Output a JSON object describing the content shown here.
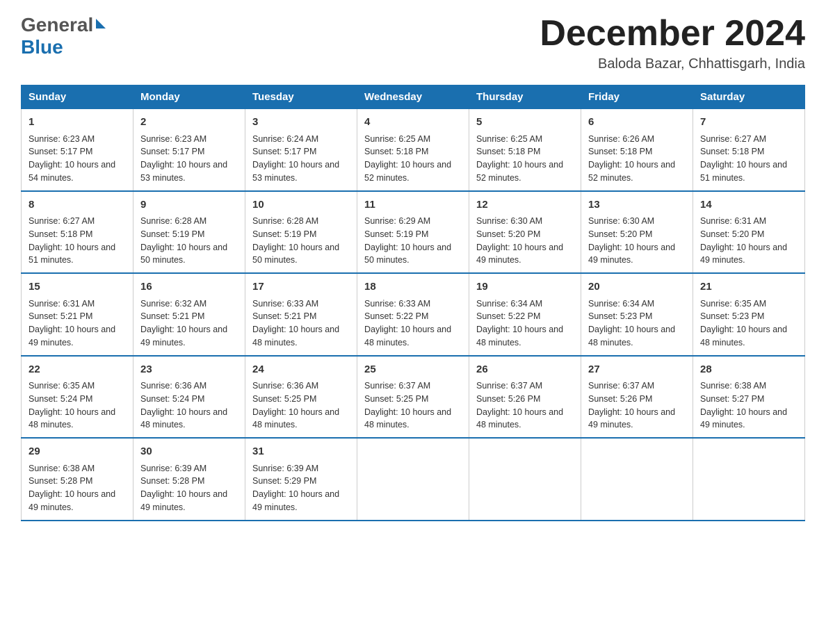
{
  "logo": {
    "line1": "General",
    "line2": "Blue"
  },
  "title": "December 2024",
  "subtitle": "Baloda Bazar, Chhattisgarh, India",
  "days": [
    "Sunday",
    "Monday",
    "Tuesday",
    "Wednesday",
    "Thursday",
    "Friday",
    "Saturday"
  ],
  "weeks": [
    [
      {
        "day": "1",
        "sunrise": "6:23 AM",
        "sunset": "5:17 PM",
        "daylight": "10 hours and 54 minutes."
      },
      {
        "day": "2",
        "sunrise": "6:23 AM",
        "sunset": "5:17 PM",
        "daylight": "10 hours and 53 minutes."
      },
      {
        "day": "3",
        "sunrise": "6:24 AM",
        "sunset": "5:17 PM",
        "daylight": "10 hours and 53 minutes."
      },
      {
        "day": "4",
        "sunrise": "6:25 AM",
        "sunset": "5:18 PM",
        "daylight": "10 hours and 52 minutes."
      },
      {
        "day": "5",
        "sunrise": "6:25 AM",
        "sunset": "5:18 PM",
        "daylight": "10 hours and 52 minutes."
      },
      {
        "day": "6",
        "sunrise": "6:26 AM",
        "sunset": "5:18 PM",
        "daylight": "10 hours and 52 minutes."
      },
      {
        "day": "7",
        "sunrise": "6:27 AM",
        "sunset": "5:18 PM",
        "daylight": "10 hours and 51 minutes."
      }
    ],
    [
      {
        "day": "8",
        "sunrise": "6:27 AM",
        "sunset": "5:18 PM",
        "daylight": "10 hours and 51 minutes."
      },
      {
        "day": "9",
        "sunrise": "6:28 AM",
        "sunset": "5:19 PM",
        "daylight": "10 hours and 50 minutes."
      },
      {
        "day": "10",
        "sunrise": "6:28 AM",
        "sunset": "5:19 PM",
        "daylight": "10 hours and 50 minutes."
      },
      {
        "day": "11",
        "sunrise": "6:29 AM",
        "sunset": "5:19 PM",
        "daylight": "10 hours and 50 minutes."
      },
      {
        "day": "12",
        "sunrise": "6:30 AM",
        "sunset": "5:20 PM",
        "daylight": "10 hours and 49 minutes."
      },
      {
        "day": "13",
        "sunrise": "6:30 AM",
        "sunset": "5:20 PM",
        "daylight": "10 hours and 49 minutes."
      },
      {
        "day": "14",
        "sunrise": "6:31 AM",
        "sunset": "5:20 PM",
        "daylight": "10 hours and 49 minutes."
      }
    ],
    [
      {
        "day": "15",
        "sunrise": "6:31 AM",
        "sunset": "5:21 PM",
        "daylight": "10 hours and 49 minutes."
      },
      {
        "day": "16",
        "sunrise": "6:32 AM",
        "sunset": "5:21 PM",
        "daylight": "10 hours and 49 minutes."
      },
      {
        "day": "17",
        "sunrise": "6:33 AM",
        "sunset": "5:21 PM",
        "daylight": "10 hours and 48 minutes."
      },
      {
        "day": "18",
        "sunrise": "6:33 AM",
        "sunset": "5:22 PM",
        "daylight": "10 hours and 48 minutes."
      },
      {
        "day": "19",
        "sunrise": "6:34 AM",
        "sunset": "5:22 PM",
        "daylight": "10 hours and 48 minutes."
      },
      {
        "day": "20",
        "sunrise": "6:34 AM",
        "sunset": "5:23 PM",
        "daylight": "10 hours and 48 minutes."
      },
      {
        "day": "21",
        "sunrise": "6:35 AM",
        "sunset": "5:23 PM",
        "daylight": "10 hours and 48 minutes."
      }
    ],
    [
      {
        "day": "22",
        "sunrise": "6:35 AM",
        "sunset": "5:24 PM",
        "daylight": "10 hours and 48 minutes."
      },
      {
        "day": "23",
        "sunrise": "6:36 AM",
        "sunset": "5:24 PM",
        "daylight": "10 hours and 48 minutes."
      },
      {
        "day": "24",
        "sunrise": "6:36 AM",
        "sunset": "5:25 PM",
        "daylight": "10 hours and 48 minutes."
      },
      {
        "day": "25",
        "sunrise": "6:37 AM",
        "sunset": "5:25 PM",
        "daylight": "10 hours and 48 minutes."
      },
      {
        "day": "26",
        "sunrise": "6:37 AM",
        "sunset": "5:26 PM",
        "daylight": "10 hours and 48 minutes."
      },
      {
        "day": "27",
        "sunrise": "6:37 AM",
        "sunset": "5:26 PM",
        "daylight": "10 hours and 49 minutes."
      },
      {
        "day": "28",
        "sunrise": "6:38 AM",
        "sunset": "5:27 PM",
        "daylight": "10 hours and 49 minutes."
      }
    ],
    [
      {
        "day": "29",
        "sunrise": "6:38 AM",
        "sunset": "5:28 PM",
        "daylight": "10 hours and 49 minutes."
      },
      {
        "day": "30",
        "sunrise": "6:39 AM",
        "sunset": "5:28 PM",
        "daylight": "10 hours and 49 minutes."
      },
      {
        "day": "31",
        "sunrise": "6:39 AM",
        "sunset": "5:29 PM",
        "daylight": "10 hours and 49 minutes."
      },
      null,
      null,
      null,
      null
    ]
  ],
  "labels": {
    "sunrise": "Sunrise:",
    "sunset": "Sunset:",
    "daylight": "Daylight:"
  }
}
